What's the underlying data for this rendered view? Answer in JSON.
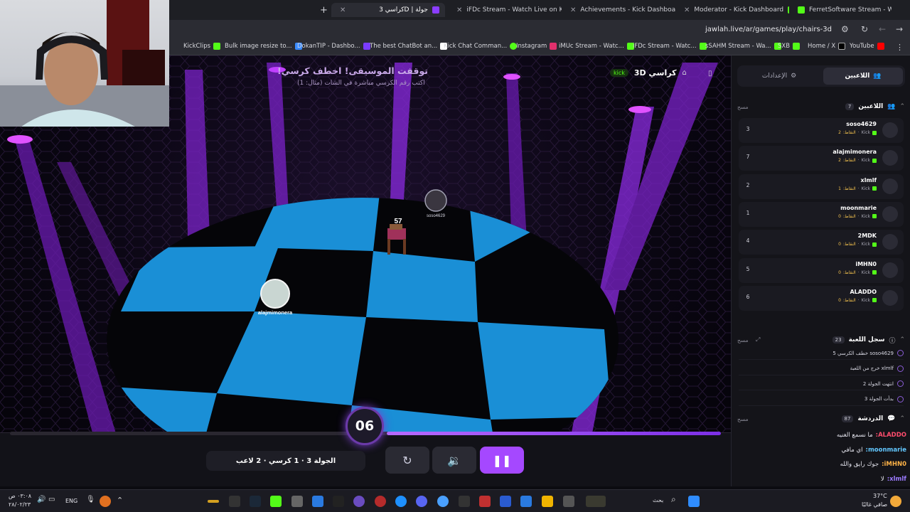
{
  "browser": {
    "tabs": [
      {
        "label": "FerretSoftware Stream - Watch",
        "icon": "kick-favicon"
      },
      {
        "label": "Moderator - Kick Dashboard",
        "icon": "kick-favicon"
      },
      {
        "label": "Achievements - Kick Dashboard",
        "icon": "kick-favicon"
      },
      {
        "label": "iFDc Stream - Watch Live on Kick",
        "icon": "kick-favicon"
      },
      {
        "label": "كراسي 3D | جولة",
        "icon": "game-favicon"
      }
    ],
    "url": "jawlah.live/ar/games/play/chairs-3d",
    "bookmarks": [
      "KickClips",
      "Bulk image resize to...",
      "DokanTIP - Dashbo...",
      "The best ChatBot an...",
      "Kick Chat Comman...",
      "Instagram",
      "iMUc Stream - Watc...",
      "iFDc Stream - Watc...",
      "sSAHM Stream - Wa...",
      "SXB",
      "Home / X",
      "YouTube"
    ]
  },
  "game": {
    "title": "توقفت الموسيقى! اخطف كرسي!",
    "subtitle": "اكتب رقم الكرسي مباشرة في الشات (مثال: 1)",
    "brand_name": "كراسي 3D",
    "brand_badge": "kick",
    "chair_number": "57",
    "player_on_chair": "soso4629",
    "player_on_floor": "alajmimonera",
    "countdown": "06",
    "round_status": "الجولة 3 · 1 كرسي · 2 لاعب",
    "progress": 0.47,
    "accent_color": "#a548ff"
  },
  "sidebar": {
    "tab_players": "اللاعبين",
    "tab_settings": "الإعدادات",
    "players_header": "اللاعبين",
    "players_count": "7",
    "clear_label": "مسح",
    "points_label": "النقاط:",
    "platform_label": "Kick",
    "players": [
      {
        "name": "soso4629",
        "points": "2",
        "rank": "3"
      },
      {
        "name": "alajmimonera",
        "points": "2",
        "rank": "7"
      },
      {
        "name": "xlmlf",
        "points": "1",
        "rank": "2"
      },
      {
        "name": "moonmarie",
        "points": "0",
        "rank": "1"
      },
      {
        "name": "2MDK",
        "points": "0",
        "rank": "4"
      },
      {
        "name": "iMHN0",
        "points": "0",
        "rank": "5"
      },
      {
        "name": "ALADDO",
        "points": "0",
        "rank": "6"
      }
    ],
    "log_header": "سجل اللعبة",
    "log_count": "23",
    "log": [
      "soso4629 خطف الكرسي 5",
      "xlmlf خرج من اللعبة",
      "انتهت الجولة 2",
      "بدأت الجولة 3"
    ],
    "chat_header": "الدردشة",
    "chat_count": "87",
    "chat": [
      {
        "user": "ALADDO:",
        "msg": "ما نسمع الغنيه",
        "color": "#ff4d6d"
      },
      {
        "user": "moonmarie:",
        "msg": "اي مافي",
        "color": "#62c7ff"
      },
      {
        "user": "iMHN0:",
        "msg": "جوك رايق والله",
        "color": "#ffb347"
      },
      {
        "user": "xlmlf:",
        "msg": "لا",
        "color": "#9c7bff"
      }
    ]
  },
  "taskbar": {
    "time": "٠٣:٠٨ ص",
    "date": "٢٨/٠٢/٢٣",
    "lang": "ENG",
    "search": "بحث",
    "weather_temp": "37°C",
    "weather_desc": "صافي غالبًا"
  }
}
